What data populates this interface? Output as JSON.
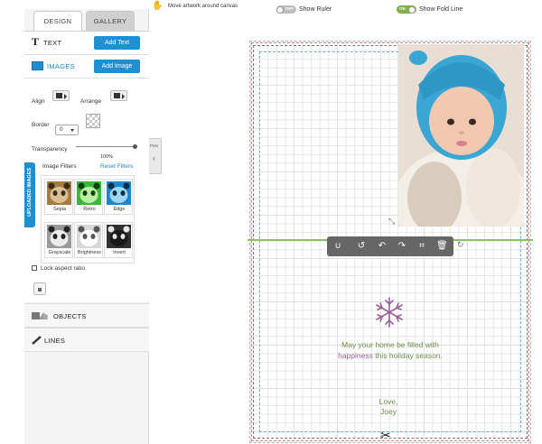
{
  "tabs": {
    "design": "DESIGN",
    "gallery": "GALLERY"
  },
  "text_section": {
    "title": "TEXT",
    "button": "Add Text"
  },
  "images_section": {
    "title": "IMAGES",
    "button": "Add Image",
    "align_label": "Align",
    "arrange_label": "Arrange",
    "border_label": "Border",
    "border_value": "0",
    "transparency_label": "Transparency",
    "transparency_value": "100%",
    "transparency_level": 1.0,
    "image_filters_label": "Image Filters",
    "reset_filters": "Reset Filters",
    "filters": [
      "Sepia",
      "Retro",
      "Edge",
      "Grayscale",
      "Brightness",
      "Invert"
    ],
    "lock_aspect": "Lock aspect ratio"
  },
  "uploaded_images_tab": "UPLOADED IMAGES",
  "objects_section": {
    "title": "OBJECTS"
  },
  "lines_section": {
    "title": "LINES"
  },
  "preview_tab": {
    "label": "Prev"
  },
  "topbar": {
    "move_artwork": "Move artwork around canvas",
    "ruler_toggle": "OFF",
    "ruler_label": "Show Ruler",
    "fold_toggle": "ON",
    "fold_label": "Show Fold Line"
  },
  "card": {
    "greeting_line1": "May your home be filled with",
    "greeting_highlight": "happiness",
    "greeting_line2_rest": "this holiday season.",
    "signoff_1": "Love,",
    "signoff_2": "Joey"
  },
  "colors": {
    "accent_blue": "#1f8fd1",
    "fold_green": "#8fbf60",
    "text_green": "#6b8f4e",
    "text_purple": "#9a5f96"
  },
  "icons": [
    "hand-icon",
    "text-icon",
    "image-icon",
    "objects-icon",
    "pencil-icon",
    "snowflake-icon",
    "scissors-icon",
    "lock-icon"
  ]
}
